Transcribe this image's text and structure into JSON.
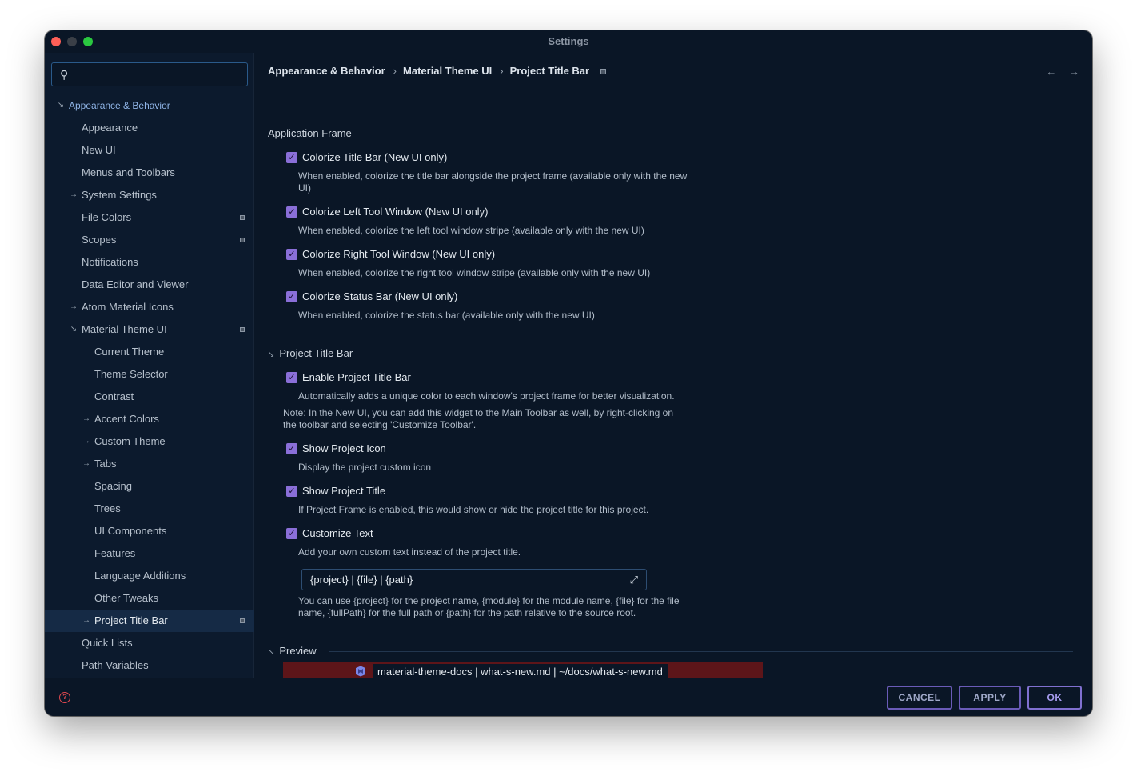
{
  "window": {
    "title": "Settings"
  },
  "search": {
    "placeholder": ""
  },
  "sidebar": {
    "items": [
      {
        "label": "Appearance & Behavior",
        "arrow": "↘",
        "level": 0,
        "badge": false
      },
      {
        "label": "Appearance",
        "arrow": "",
        "level": 1,
        "badge": false
      },
      {
        "label": "New UI",
        "arrow": "",
        "level": 1,
        "badge": false
      },
      {
        "label": "Menus and Toolbars",
        "arrow": "",
        "level": 1,
        "badge": false
      },
      {
        "label": "System Settings",
        "arrow": "→",
        "level": 1,
        "badge": false
      },
      {
        "label": "File Colors",
        "arrow": "",
        "level": 1,
        "badge": true
      },
      {
        "label": "Scopes",
        "arrow": "",
        "level": 1,
        "badge": true
      },
      {
        "label": "Notifications",
        "arrow": "",
        "level": 1,
        "badge": false
      },
      {
        "label": "Data Editor and Viewer",
        "arrow": "",
        "level": 1,
        "badge": false
      },
      {
        "label": "Atom Material Icons",
        "arrow": "→",
        "level": 1,
        "badge": false
      },
      {
        "label": "Material Theme UI",
        "arrow": "↘",
        "level": 1,
        "badge": true
      },
      {
        "label": "Current Theme",
        "arrow": "",
        "level": 2,
        "badge": false
      },
      {
        "label": "Theme Selector",
        "arrow": "",
        "level": 2,
        "badge": false
      },
      {
        "label": "Contrast",
        "arrow": "",
        "level": 2,
        "badge": false
      },
      {
        "label": "Accent Colors",
        "arrow": "→",
        "level": 2,
        "badge": false
      },
      {
        "label": "Custom Theme",
        "arrow": "→",
        "level": 2,
        "badge": false
      },
      {
        "label": "Tabs",
        "arrow": "→",
        "level": 2,
        "badge": false
      },
      {
        "label": "Spacing",
        "arrow": "",
        "level": 2,
        "badge": false
      },
      {
        "label": "Trees",
        "arrow": "",
        "level": 2,
        "badge": false
      },
      {
        "label": "UI Components",
        "arrow": "",
        "level": 2,
        "badge": false
      },
      {
        "label": "Features",
        "arrow": "",
        "level": 2,
        "badge": false
      },
      {
        "label": "Language Additions",
        "arrow": "",
        "level": 2,
        "badge": false
      },
      {
        "label": "Other Tweaks",
        "arrow": "",
        "level": 2,
        "badge": false
      },
      {
        "label": "Project Title Bar",
        "arrow": "→",
        "level": 2,
        "badge": true,
        "selected": true
      },
      {
        "label": "Quick Lists",
        "arrow": "",
        "level": 1,
        "badge": false
      },
      {
        "label": "Path Variables",
        "arrow": "",
        "level": 1,
        "badge": false
      }
    ]
  },
  "breadcrumb": {
    "items": [
      "Appearance & Behavior",
      "Material Theme UI",
      "Project Title Bar"
    ],
    "separator": "›"
  },
  "nav": {
    "back": "←",
    "forward": "→"
  },
  "application_frame": {
    "title": "Application Frame",
    "options": [
      {
        "label": "Colorize Title Bar (New UI only)",
        "checked": true,
        "desc": "When enabled, colorize the title bar alongside the project frame (available only with the new UI)"
      },
      {
        "label": "Colorize Left Tool Window (New UI only)",
        "checked": true,
        "desc": "When enabled, colorize the left tool window stripe (available only with the new UI)"
      },
      {
        "label": "Colorize Right Tool Window (New UI only)",
        "checked": true,
        "desc": "When enabled, colorize the right tool window stripe (available only with the new UI)"
      },
      {
        "label": "Colorize Status Bar (New UI only)",
        "checked": true,
        "desc": "When enabled, colorize the status bar (available only with the new UI)"
      }
    ]
  },
  "project_title_bar": {
    "title": "Project Title Bar",
    "enable_label": "Enable Project Title Bar",
    "enable_desc": "Automatically adds a unique color to each window's project frame for better visualization.",
    "note": "Note: In the New UI, you can add this widget to the Main Toolbar as well, by right-clicking on the toolbar and selecting 'Customize Toolbar'.",
    "show_icon_label": "Show Project Icon",
    "show_icon_desc": "Display the project custom icon",
    "show_title_label": "Show Project Title",
    "show_title_desc": "If Project Frame is enabled, this would show or hide the project title for this project.",
    "customize_label": "Customize Text",
    "customize_desc": "Add your own custom text instead of the project title.",
    "text_value": "{project} | {file} | {path}",
    "help_text": "You can use {project} for the project name, {module} for the module name, {file} for the file name, {fullPath} for the full path or {path} for the path relative to the source root."
  },
  "preview": {
    "title": "Preview",
    "text": "material-theme-docs | what-s-new.md | ~/docs/what-s-new.md",
    "bg_color": "#5d1519"
  },
  "footer": {
    "help_icon": "question-icon",
    "cancel": "CANCEL",
    "apply": "APPLY",
    "ok": "OK"
  },
  "colors": {
    "accent": "#8a6fd8",
    "background": "#0a1626",
    "sidebar": "#0c1a2d"
  }
}
